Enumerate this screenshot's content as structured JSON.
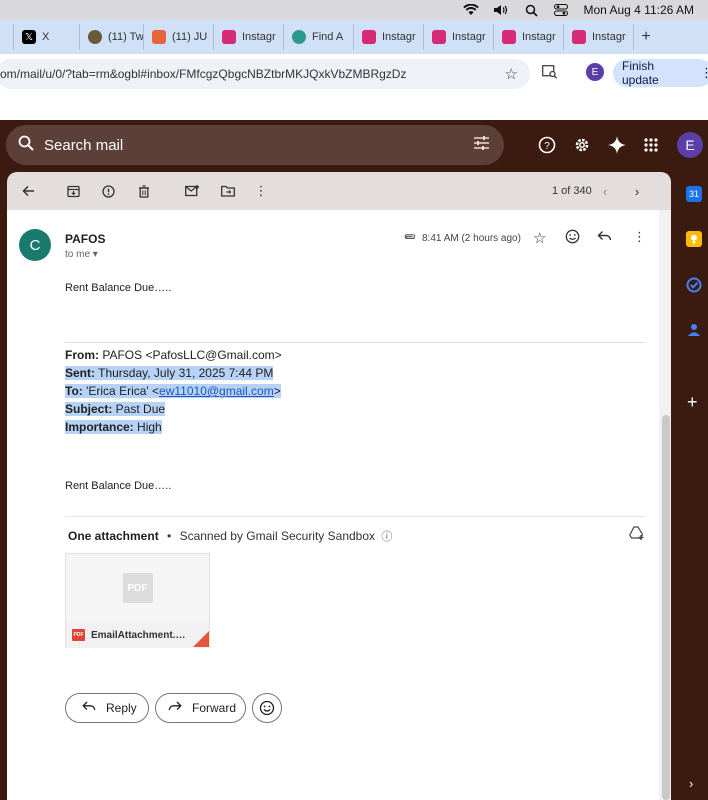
{
  "menubar": {
    "clock": "Mon Aug 4  11:26 AM"
  },
  "tabs": [
    {
      "label": "",
      "icon": "tab-partial-icon",
      "color": "#cfe0f7"
    },
    {
      "label": "X",
      "icon": "x-logo-icon",
      "color": "#000000"
    },
    {
      "label": "(11) Tw",
      "icon": "avatar-favicon-icon",
      "color": "#6b5a3a"
    },
    {
      "label": "(11) JU",
      "icon": "bookmark-favicon-icon",
      "color": "#e8643a"
    },
    {
      "label": "Instagr",
      "icon": "instagram-icon",
      "color": "#d62976"
    },
    {
      "label": "Find A",
      "icon": "globe-icon",
      "color": "#2a9a8a"
    },
    {
      "label": "Instagr",
      "icon": "instagram-icon",
      "color": "#d62976"
    },
    {
      "label": "Instagr",
      "icon": "instagram-icon",
      "color": "#d62976"
    },
    {
      "label": "Instagr",
      "icon": "instagram-icon",
      "color": "#d62976"
    },
    {
      "label": "Instagr",
      "icon": "instagram-icon",
      "color": "#d62976"
    }
  ],
  "browser": {
    "url": "om/mail/u/0/?tab=rm&ogbl#inbox/FMfcgzQbgcNBZtbrMKJQxkVbZMBRgzDz",
    "profile_initial": "E",
    "finish_update": "Finish update"
  },
  "gmail": {
    "search_placeholder": "Search mail",
    "account_initial": "E",
    "pager": "1 of 340"
  },
  "message": {
    "sender_initial": "C",
    "sender": "PAFOS",
    "to_me": "to me",
    "time": "8:41 AM (2 hours ago)",
    "body_1": "Rent  Balance Due…..",
    "quoted": {
      "from_label": "From:",
      "from_value": " PAFOS <PafosLLC@Gmail.com>",
      "sent_label": "Sent:",
      "sent_value": " Thursday, July 31, 2025 7:44 PM",
      "to_label": "To:",
      "to_value_pre": " 'Erica Erica' <",
      "to_email": "ew11010@gmail.com",
      "to_value_post": ">",
      "subject_label": "Subject:",
      "subject_value": " Past Due",
      "importance_label": "Importance:",
      "importance_value": " High"
    },
    "body_2": "Rent  Balance Due….."
  },
  "attachments": {
    "heading": "One attachment",
    "separator": "•",
    "scan_note": "Scanned by Gmail Security Sandbox",
    "file_name": "EmailAttachment.…",
    "preview_label": "PDF",
    "badge_label": "PDF"
  },
  "actions": {
    "reply": "Reply",
    "forward": "Forward"
  },
  "colors": {
    "gmail_theme": "#3b1a10",
    "accent_avatar": "#5b3fa8",
    "sender_avatar": "#1b7a6e",
    "highlight": "#b6d2f7"
  }
}
